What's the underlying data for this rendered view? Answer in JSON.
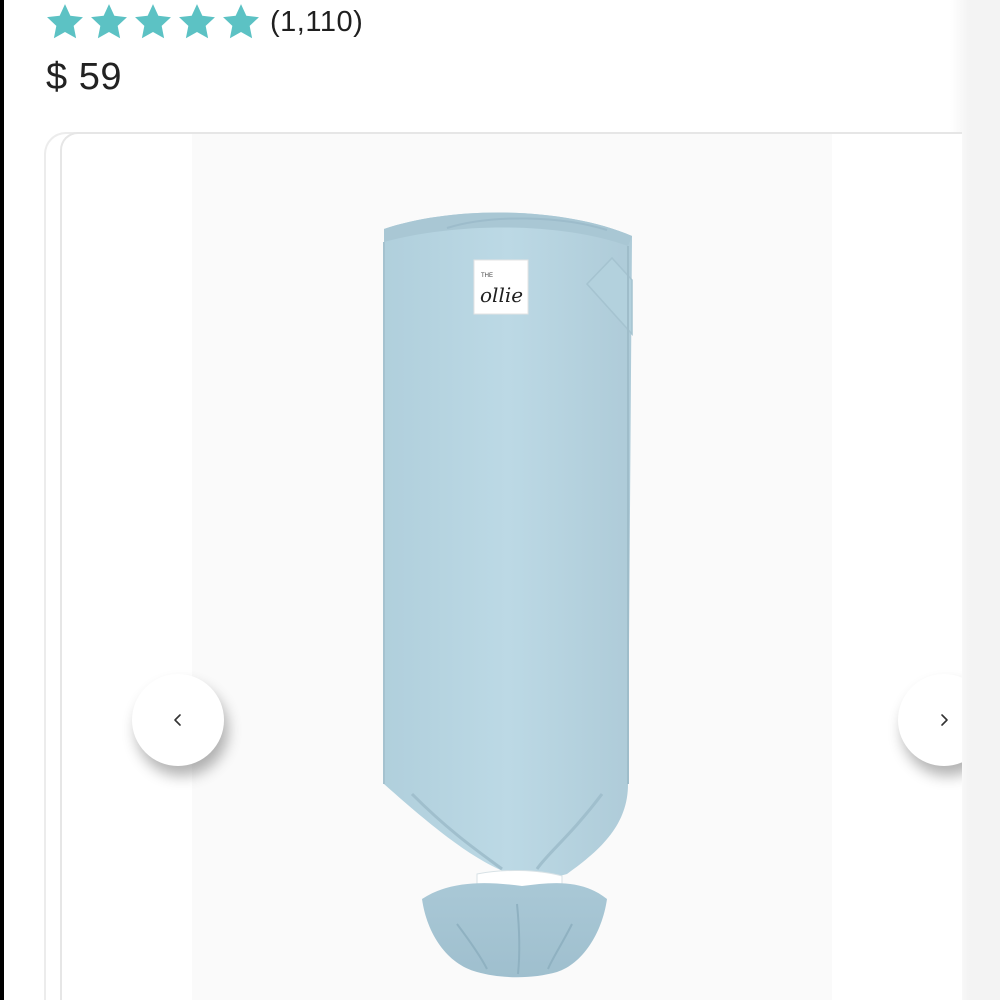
{
  "product": {
    "rating_stars": 5,
    "review_count": "(1,110)",
    "price": "$ 59",
    "image": {
      "description_label": "the ollie",
      "brand_tag_small": "THE",
      "brand_tag_script": "ollie"
    }
  },
  "carousel": {
    "prev_icon": "chevron-left-icon",
    "next_icon": "chevron-right-icon"
  },
  "colors": {
    "star": "#5cc2c4",
    "swaddle": "#b9d6e2",
    "text": "#222222"
  }
}
